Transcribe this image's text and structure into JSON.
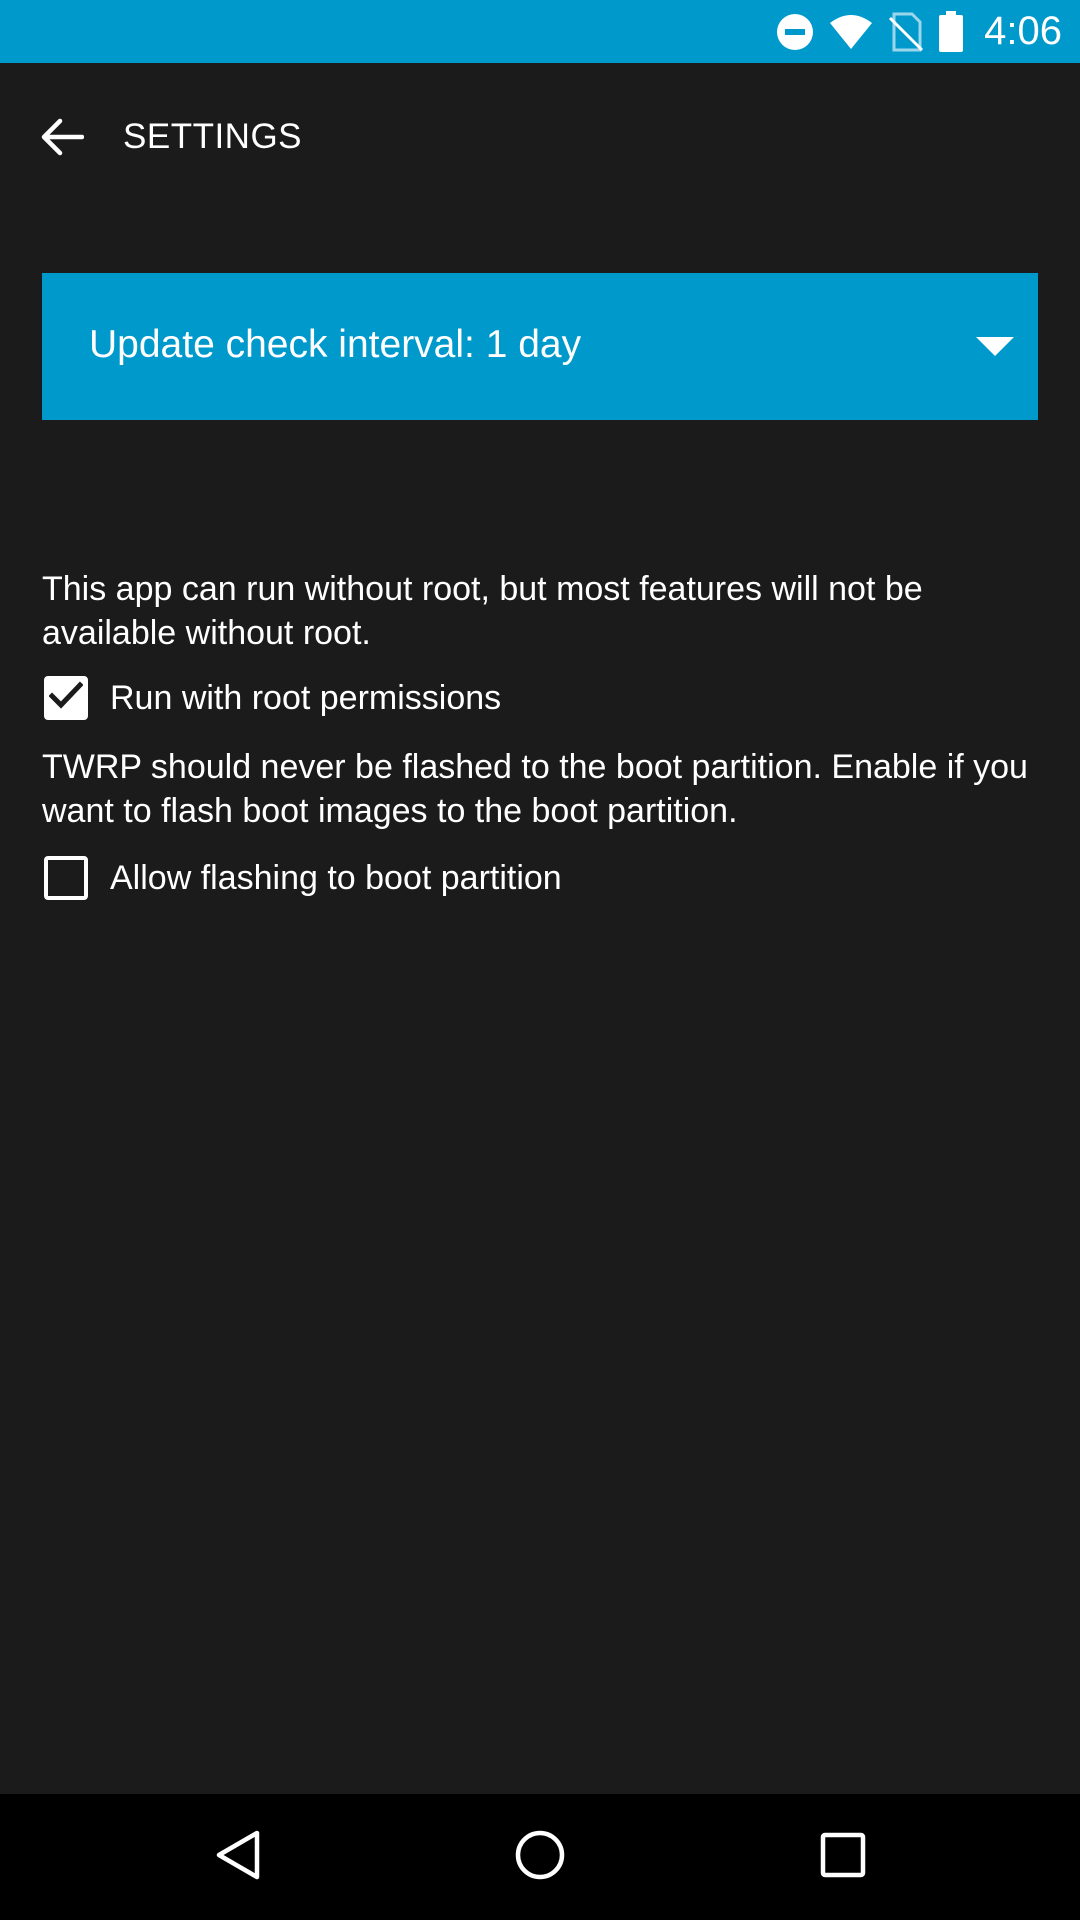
{
  "status_bar": {
    "time": "4:06",
    "background": "#0099cc",
    "icons": [
      "do-not-disturb-icon",
      "wifi-icon",
      "no-sim-icon",
      "battery-icon"
    ]
  },
  "toolbar": {
    "title": "SETTINGS",
    "back_icon": "arrow-left-icon"
  },
  "update_interval": {
    "label": "Update check interval: 1 day",
    "accent": "#0099cc"
  },
  "root": {
    "description": "This app can run without root, but most features will not be available without root.",
    "checkbox_label": "Run with root permissions",
    "checked": true
  },
  "boot": {
    "description": "TWRP should never be flashed to the boot partition. Enable if you want to flash boot images to the boot partition.",
    "checkbox_label": "Allow flashing to boot partition",
    "checked": false
  },
  "nav_bar": {
    "icons": [
      "back-triangle-icon",
      "home-circle-icon",
      "recents-square-icon"
    ]
  }
}
